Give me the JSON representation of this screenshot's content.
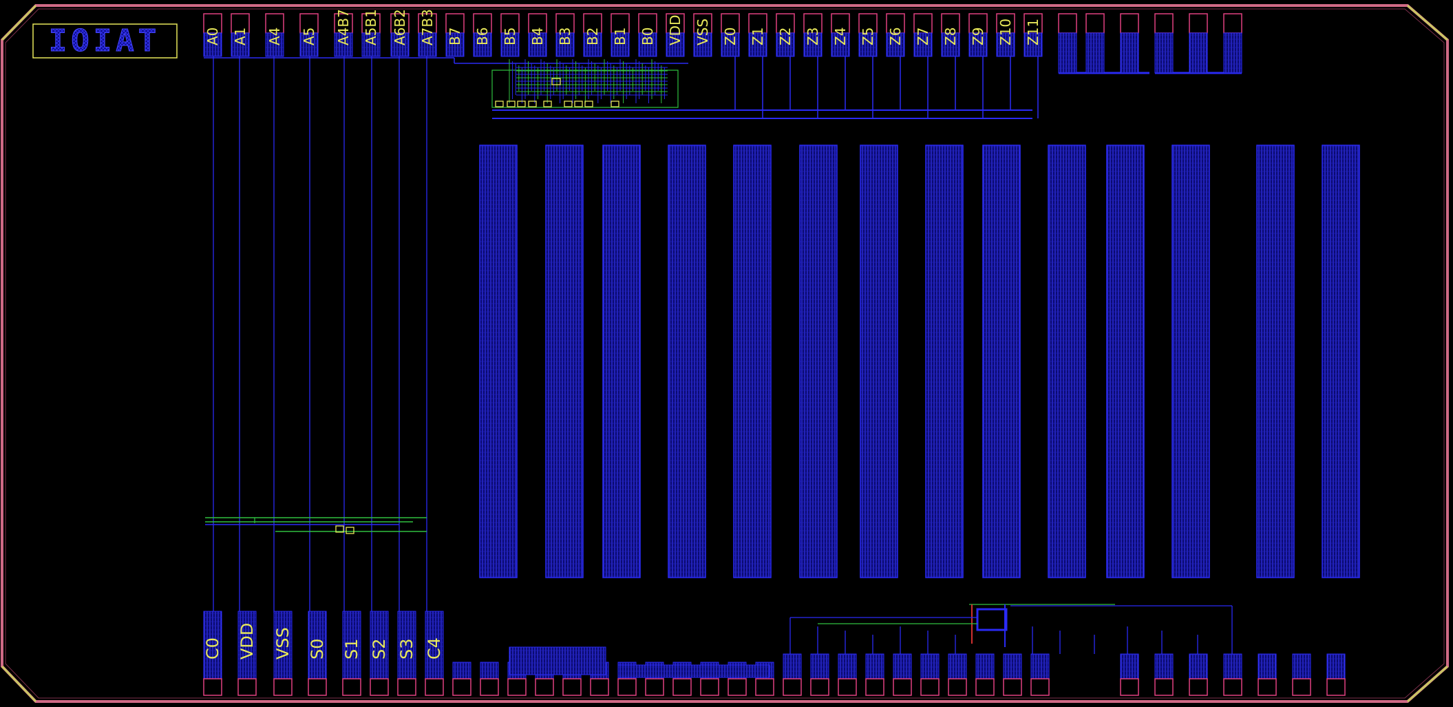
{
  "colors": {
    "background": "#000000",
    "metal_blue": "#2a2af5",
    "metal_fill": "#1a1ad0",
    "pad_pink": "#e04080",
    "label_yellow": "#e8e85a",
    "boundary_pink": "#d06a86",
    "corner_yellow": "#c8c860",
    "route_green": "#30c040",
    "route_red": "#d03030"
  },
  "logo": {
    "text": "IOIAT"
  },
  "pads": {
    "top_labels": [
      "A0",
      "A1",
      "A4",
      "A5",
      "A4B7",
      "A5B1",
      "A6B2",
      "A7B3",
      "B7",
      "B6",
      "B5",
      "B4",
      "B3",
      "B2",
      "B1",
      "B0",
      "VDD",
      "VSS",
      "Z0",
      "Z1",
      "Z2",
      "Z3",
      "Z4",
      "Z5",
      "Z6",
      "Z7",
      "Z8",
      "Z9",
      "Z10",
      "Z11"
    ],
    "top_unlabeled": 6,
    "bottom_labels": [
      "C0",
      "VDD",
      "VSS",
      "S0",
      "S1",
      "S2",
      "S3",
      "C4"
    ],
    "bottom_unlabeled": 29
  },
  "array": {
    "columns": 14
  }
}
